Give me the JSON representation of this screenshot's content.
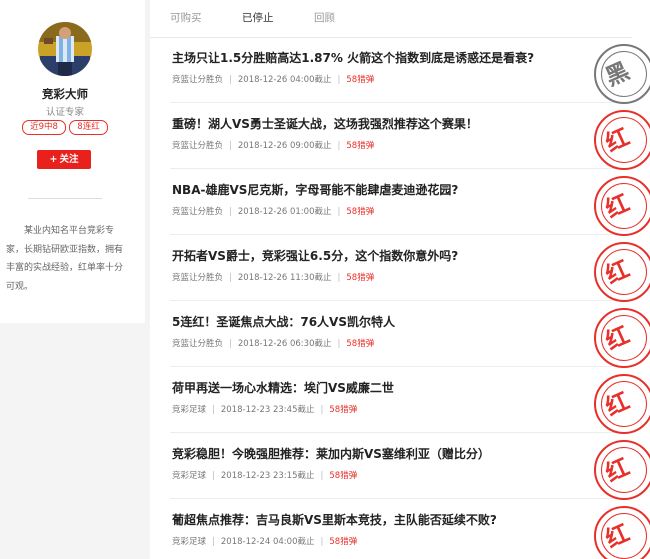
{
  "profile": {
    "name": "竞彩大师",
    "tag": "认证专家",
    "badges": [
      "近9中8",
      "8连红"
    ],
    "follow_label": "关注",
    "bio": "某业内知名平台竞彩专家，长期钻研欧亚指数，拥有丰富的实战经验，红单率十分可观。"
  },
  "tabs": [
    "可购买",
    "已停止",
    "回顾"
  ],
  "active_tab": "已停止",
  "articles": [
    {
      "title": "主场只让1.5分胜赔高达1.87% 火箭这个指数到底是诱惑还是看衰?",
      "category": "竞篮让分胜负",
      "time": "2018-12-26 04:00截止",
      "price": "58猎弹",
      "result": "黑"
    },
    {
      "title": "重磅！湖人VS勇士圣诞大战，这场我强烈推荐这个赛果！",
      "category": "竞篮让分胜负",
      "time": "2018-12-26 09:00截止",
      "price": "58猎弹",
      "result": "红"
    },
    {
      "title": "NBA-雄鹿VS尼克斯，字母哥能不能肆虐麦迪逊花园?",
      "category": "竞篮让分胜负",
      "time": "2018-12-26 01:00截止",
      "price": "58猎弹",
      "result": "红"
    },
    {
      "title": "开拓者VS爵士，竞彩强让6.5分，这个指数你意外吗?",
      "category": "竞篮让分胜负",
      "time": "2018-12-26 11:30截止",
      "price": "58猎弹",
      "result": "红"
    },
    {
      "title": "5连红！圣诞焦点大战：76人VS凯尔特人",
      "category": "竞篮让分胜负",
      "time": "2018-12-26 06:30截止",
      "price": "58猎弹",
      "result": "红"
    },
    {
      "title": "荷甲再送一场心水精选：埃门VS威廉二世",
      "category": "竞彩足球",
      "time": "2018-12-23 23:45截止",
      "price": "58猎弹",
      "result": "红"
    },
    {
      "title": "竞彩稳胆！今晚强胆推荐：莱加内斯VS塞维利亚（赠比分）",
      "category": "竞彩足球",
      "time": "2018-12-23 23:15截止",
      "price": "58猎弹",
      "result": "红"
    },
    {
      "title": "葡超焦点推荐：吉马良斯VS里斯本竞技，主队能否延续不败?",
      "category": "竞彩足球",
      "time": "2018-12-24 04:00截止",
      "price": "58猎弹",
      "result": "红"
    }
  ],
  "colors": {
    "accent": "#e8211c",
    "stamp_red": "#e8302a",
    "stamp_black": "#777777"
  }
}
